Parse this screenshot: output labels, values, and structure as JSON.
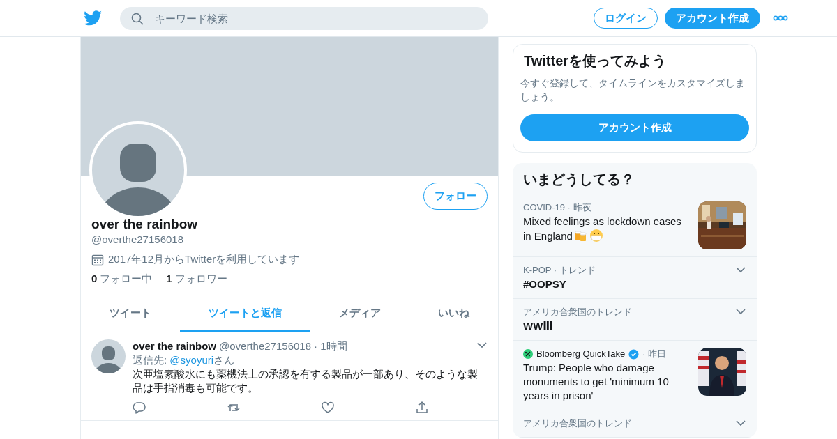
{
  "header": {
    "search_placeholder": "キーワード検索",
    "login": "ログイン",
    "signup": "アカウント作成"
  },
  "profile": {
    "name": "over the rainbow",
    "handle": "@overthe27156018",
    "follow": "フォロー",
    "joined": "2017年12月からTwitterを利用しています",
    "following_count": "0",
    "following_label": "フォロー中",
    "followers_count": "1",
    "followers_label": "フォロワー"
  },
  "tabs": [
    {
      "label": "ツイート",
      "selected": false
    },
    {
      "label": "ツイートと返信",
      "selected": true
    },
    {
      "label": "メディア",
      "selected": false
    },
    {
      "label": "いいね",
      "selected": false
    }
  ],
  "tweets": [
    {
      "name": "over the rainbow",
      "handle": "@overthe27156018",
      "time": "· 1時間",
      "reply_prefix": "返信先:",
      "reply_to": "@syoyuri",
      "reply_suffix": "さん",
      "text": "次亜塩素酸水にも薬機法上の承認を有する製品が一部あり、そのような製品は手指消毒も可能です。"
    }
  ],
  "signup_card": {
    "title": "Twitterを使ってみよう",
    "text": "今すぐ登録して、タイムラインをカスタマイズしましょう。",
    "button": "アカウント作成"
  },
  "trends": {
    "title": "いまどうしてる？",
    "items": [
      {
        "kind": "story",
        "meta": "COVID-19 · 昨夜",
        "title": "Mixed feelings as lockdown eases in England"
      },
      {
        "kind": "trend",
        "meta": "K-POP · トレンド",
        "title": "#OOPSY"
      },
      {
        "kind": "trend",
        "meta": "アメリカ合衆国のトレンド",
        "title": "WWⅢ"
      },
      {
        "kind": "story",
        "source": "Bloomberg QuickTake",
        "verified": true,
        "meta": "· 昨日",
        "title": "Trump: People who damage monuments to get 'minimum 10 years in prison'"
      },
      {
        "kind": "trend",
        "meta": "アメリカ合衆国のトレンド"
      }
    ]
  }
}
